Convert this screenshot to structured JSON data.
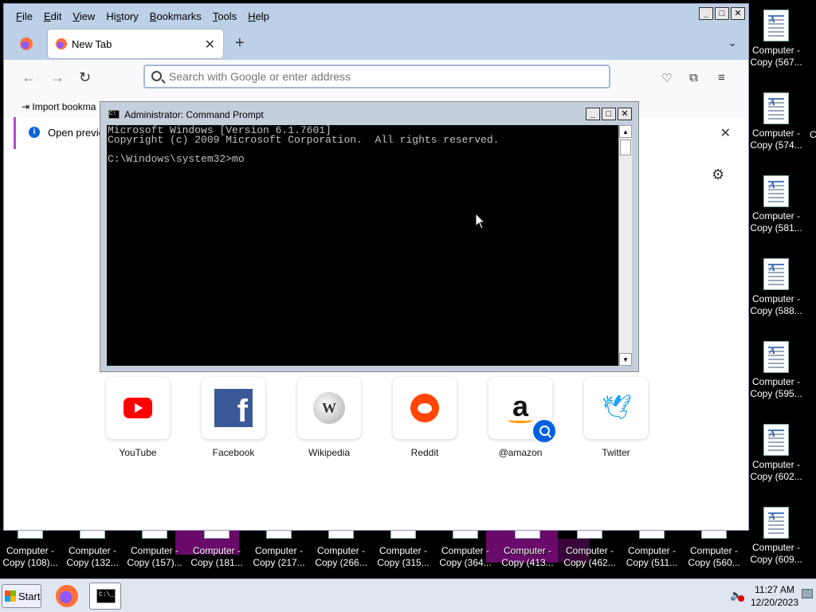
{
  "firefox": {
    "menu": [
      {
        "label": "File",
        "key": "F",
        "rest": "ile"
      },
      {
        "label": "Edit",
        "key": "E",
        "rest": "dit"
      },
      {
        "label": "View",
        "key": "V",
        "rest": "iew"
      },
      {
        "label": "History",
        "key": "",
        "pre": "Hi",
        "key2": "s",
        "rest": "tory"
      },
      {
        "label": "Bookmarks",
        "key": "B",
        "rest": "ookmarks"
      },
      {
        "label": "Tools",
        "key": "T",
        "rest": "ools"
      },
      {
        "label": "Help",
        "key": "H",
        "rest": "elp"
      }
    ],
    "tab_title": "New Tab",
    "url_placeholder": "Search with Google or enter address",
    "import_bookmarks": "Import bookma",
    "notice_text": "Open previou",
    "shortcuts": [
      {
        "name": "YouTube",
        "icon": "youtube-icon"
      },
      {
        "name": "Facebook",
        "icon": "facebook-icon"
      },
      {
        "name": "Wikipedia",
        "icon": "wikipedia-icon"
      },
      {
        "name": "Reddit",
        "icon": "reddit-icon"
      },
      {
        "name": "@amazon",
        "icon": "amazon-icon"
      },
      {
        "name": "Twitter",
        "icon": "twitter-icon"
      }
    ],
    "accent_color": "#0061e0"
  },
  "cmd": {
    "title": "Administrator: Command Prompt",
    "lines": "Microsoft Windows [Version 6.1.7601]\nCopyright (c) 2009 Microsoft Corporation.  All rights reserved.\n\nC:\\Windows\\system32>mo"
  },
  "desktop": {
    "right_icons": [
      {
        "line1": "Computer -",
        "line2": "Copy (567..."
      },
      {
        "line1": "Computer -",
        "line2": "Copy (574..."
      },
      {
        "line1": "Computer -",
        "line2": "Copy (581..."
      },
      {
        "line1": "Computer -",
        "line2": "Copy (588..."
      },
      {
        "line1": "Computer -",
        "line2": "Copy (595..."
      },
      {
        "line1": "Computer -",
        "line2": "Copy (602..."
      },
      {
        "line1": "Computer -",
        "line2": "Copy (609..."
      }
    ],
    "bottom_icons": [
      {
        "line1": "Computer -",
        "line2": "Copy (108)..."
      },
      {
        "line1": "Computer -",
        "line2": "Copy (132..."
      },
      {
        "line1": "Computer -",
        "line2": "Copy (157)..."
      },
      {
        "line1": "Computer -",
        "line2": "Copy (181..."
      },
      {
        "line1": "Computer -",
        "line2": "Copy (217..."
      },
      {
        "line1": "Computer -",
        "line2": "Copy (266..."
      },
      {
        "line1": "Computer -",
        "line2": "Copy (315..."
      },
      {
        "line1": "Computer -",
        "line2": "Copy (364..."
      },
      {
        "line1": "Computer -",
        "line2": "Copy (413..."
      },
      {
        "line1": "Computer -",
        "line2": "Copy (462..."
      },
      {
        "line1": "Computer -",
        "line2": "Copy (511..."
      },
      {
        "line1": "Computer -",
        "line2": "Copy (560..."
      }
    ],
    "edge_glyph": "C"
  },
  "taskbar": {
    "start_label": "Start",
    "time": "11:27 AM",
    "date": "12/20/2023",
    "cmd_glyph": "C:\\_"
  }
}
